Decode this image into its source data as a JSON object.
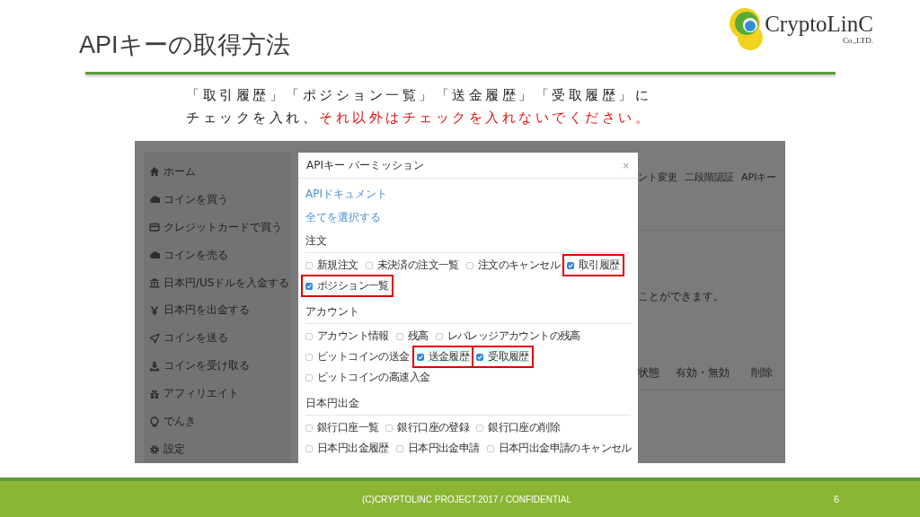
{
  "slide": {
    "title": "APIキーの取得方法",
    "logo": {
      "name": "CryptoLinC",
      "subtitle": "Co.,LTD."
    }
  },
  "instruction": [
    [
      {
        "text": "「取引履歴」「ポジション一覧」「送金履歴」「受取履歴」に",
        "emphasis": false
      }
    ],
    [
      {
        "text": "チェックを入れ、",
        "emphasis": false
      },
      {
        "text": "それ以外はチェックを入れないでください。",
        "emphasis": true
      }
    ]
  ],
  "screenshot": {
    "sidebar": {
      "items": [
        {
          "kind": "home",
          "label": "ホーム"
        },
        {
          "kind": "cloud",
          "label": "コインを買う"
        },
        {
          "kind": "card",
          "label": "クレジットカードで買う"
        },
        {
          "kind": "cloud",
          "label": "コインを売る"
        },
        {
          "kind": "bank",
          "label": "日本円/USドルを入金する"
        },
        {
          "kind": "yen",
          "label": "日本円を出金する"
        },
        {
          "kind": "plane",
          "label": "コインを送る"
        },
        {
          "kind": "download",
          "label": "コインを受け取る"
        },
        {
          "kind": "gift",
          "label": "アフィリエイト"
        },
        {
          "kind": "bulb",
          "label": "でんき"
        },
        {
          "kind": "gear",
          "label": "設定"
        }
      ]
    },
    "tabs": [
      "ント変更",
      "二段階認証",
      "APIキー"
    ],
    "page_text": "ことができます。",
    "table": {
      "columns": [
        "状態",
        "有効・無効",
        "削除"
      ]
    },
    "modal": {
      "title": "APIキー パーミッション",
      "close": "×",
      "links": [
        "APIドキュメント",
        "全てを選択する"
      ],
      "sections": [
        {
          "heading": "注文",
          "rows": [
            [
              {
                "label": "新規注文",
                "checked": false,
                "highlighted": false
              },
              {
                "label": "未決済の注文一覧",
                "checked": false,
                "highlighted": false
              },
              {
                "label": "注文のキャンセル",
                "checked": false,
                "highlighted": false
              },
              {
                "label": "取引履歴",
                "checked": true,
                "highlighted": true
              }
            ],
            [
              {
                "label": "ポジション一覧",
                "checked": true,
                "highlighted": true
              }
            ]
          ]
        },
        {
          "heading": "アカウント",
          "rows": [
            [
              {
                "label": "アカウント情報",
                "checked": false,
                "highlighted": false
              },
              {
                "label": "残高",
                "checked": false,
                "highlighted": false
              },
              {
                "label": "レバレッジアカウントの残高",
                "checked": false,
                "highlighted": false
              }
            ],
            [
              {
                "label": "ビットコインの送金",
                "checked": false,
                "highlighted": false
              },
              {
                "label": "送金履歴",
                "checked": true,
                "highlighted": true
              },
              {
                "label": "受取履歴",
                "checked": true,
                "highlighted": true
              }
            ],
            [
              {
                "label": "ビットコインの高速入金",
                "checked": false,
                "highlighted": false
              }
            ]
          ]
        },
        {
          "heading": "日本円出金",
          "rows": [
            [
              {
                "label": "銀行口座一覧",
                "checked": false,
                "highlighted": false
              },
              {
                "label": "銀行口座の登録",
                "checked": false,
                "highlighted": false
              },
              {
                "label": "銀行口座の削除",
                "checked": false,
                "highlighted": false
              }
            ],
            [
              {
                "label": "日本円出金履歴",
                "checked": false,
                "highlighted": false
              },
              {
                "label": "日本円出金申請",
                "checked": false,
                "highlighted": false
              },
              {
                "label": "日本円出金申請のキャンセル",
                "checked": false,
                "highlighted": false
              }
            ]
          ]
        }
      ]
    }
  },
  "footer": {
    "text": "(C)CRYPTOLINC PROJECT.2017 / CONFIDENTIAL",
    "page": "6"
  }
}
